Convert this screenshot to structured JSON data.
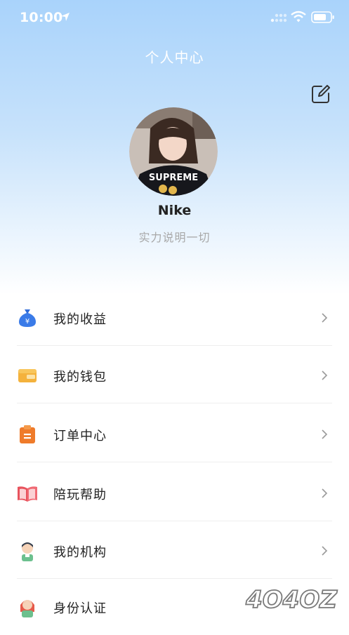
{
  "status_bar": {
    "time": "10:00"
  },
  "header": {
    "title": "个人中心"
  },
  "profile": {
    "name": "Nike",
    "bio": "实力说明一切",
    "avatar_text": "SUPREME"
  },
  "menu": [
    {
      "label": "我的收益",
      "icon": "money-bag-icon"
    },
    {
      "label": "我的钱包",
      "icon": "wallet-icon"
    },
    {
      "label": "订单中心",
      "icon": "order-clipboard-icon"
    },
    {
      "label": "陪玩帮助",
      "icon": "book-icon"
    },
    {
      "label": "我的机构",
      "icon": "boy-avatar-icon"
    },
    {
      "label": "身份认证",
      "icon": "girl-avatar-icon"
    }
  ],
  "watermark": {
    "text": "4O4OZ"
  },
  "colors": {
    "header_gradient_top": "#a9d3fb",
    "text_primary": "#222222",
    "text_secondary": "#a8a8a8"
  }
}
